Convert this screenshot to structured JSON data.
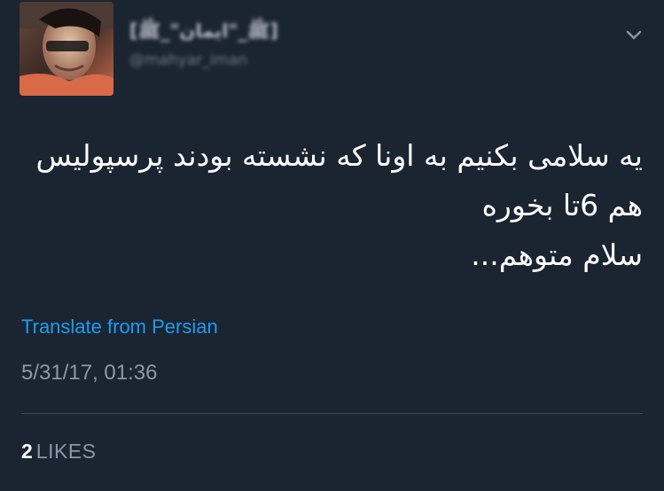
{
  "author": {
    "display_name": "[ﷺ_\"ایمان\"_ﷺ]",
    "handle": "@mahyar_iman",
    "avatar_icon": "profile-photo"
  },
  "tweet": {
    "lines": [
      "یه سلامی بکنیم به اونا که نشسته بودند پرسپولیس",
      "هم 6تا بخوره",
      "سلام متوهم..."
    ],
    "translate_label": "Translate from Persian",
    "timestamp": "5/31/17, 01:36",
    "likes_count": "2",
    "likes_label": "LIKES"
  },
  "menu": {
    "icon": "chevron-down-icon"
  },
  "colors": {
    "background": "#1b2532",
    "link": "#1d9bf0",
    "muted": "#8b98a5",
    "text": "#ffffff"
  }
}
